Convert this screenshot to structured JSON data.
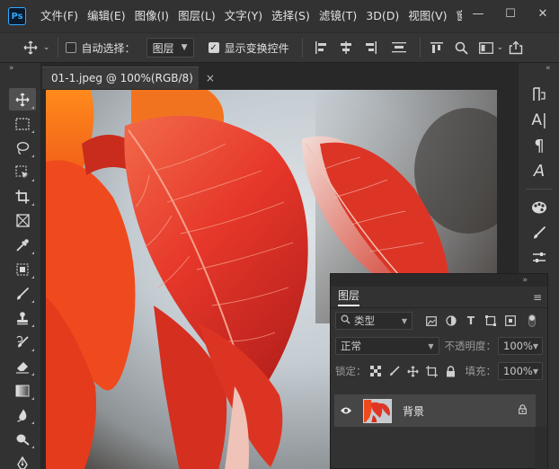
{
  "app": {
    "logo_text": "Ps",
    "accent": "#31a8ff"
  },
  "menu": [
    "文件(F)",
    "编辑(E)",
    "图像(I)",
    "图层(L)",
    "文字(Y)",
    "选择(S)",
    "滤镜(T)",
    "3D(D)",
    "视图(V)",
    "窗口"
  ],
  "window_controls": {
    "minimize": "—",
    "maximize": "☐",
    "close": "✕"
  },
  "options_bar": {
    "auto_select_label": "自动选择：",
    "auto_select_checked": false,
    "auto_select_target": "图层",
    "show_transform_label": "显示变换控件",
    "show_transform_checked": true
  },
  "document": {
    "tab_title": "01-1.jpeg @ 100%(RGB/8)",
    "tab_close": "×"
  },
  "tools": [
    "move-tool",
    "marquee-tool",
    "lasso-tool",
    "object-selection-tool",
    "crop-tool",
    "frame-tool",
    "eyedropper-tool",
    "spot-healing-tool",
    "brush-tool",
    "clone-stamp-tool",
    "history-brush-tool",
    "eraser-tool",
    "gradient-tool",
    "blur-tool",
    "dodge-tool",
    "pen-tool"
  ],
  "layers_panel": {
    "title": "图层",
    "filter_label": "类型",
    "blend_mode": "正常",
    "opacity_label": "不透明度：",
    "opacity_value": "100%",
    "lock_label": "锁定：",
    "fill_label": "填充：",
    "fill_value": "100%",
    "layers": [
      {
        "name": "背景",
        "visible": true,
        "locked": true
      }
    ]
  }
}
